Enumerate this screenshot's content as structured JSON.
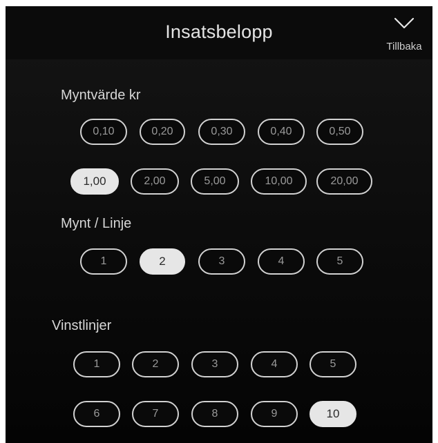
{
  "header": {
    "title": "Insatsbelopp",
    "back_label": "Tillbaka",
    "back_icon": "chevron-down-icon"
  },
  "coin_value": {
    "label": "Myntvärde kr",
    "options": [
      "0,10",
      "0,20",
      "0,30",
      "0,40",
      "0,50",
      "1,00",
      "2,00",
      "5,00",
      "10,00",
      "20,00"
    ],
    "selected": "1,00"
  },
  "coins_per_line": {
    "label": "Mynt / Linje",
    "options": [
      "1",
      "2",
      "3",
      "4",
      "5"
    ],
    "selected": "2"
  },
  "win_lines": {
    "label": "Vinstlinjer",
    "options": [
      "1",
      "2",
      "3",
      "4",
      "5",
      "6",
      "7",
      "8",
      "9",
      "10"
    ],
    "selected": "10"
  },
  "colors": {
    "background": "#0d0d0d",
    "pill_border": "#d2d2d2",
    "pill_text": "#9a9a9a",
    "selected_fill": "#e6e6e6",
    "selected_text": "#2a2a2a"
  }
}
